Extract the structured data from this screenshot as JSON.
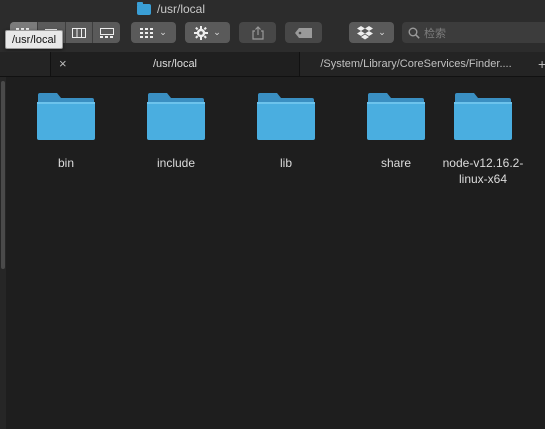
{
  "window": {
    "title": "/usr/local"
  },
  "tooltip": "/usr/local",
  "toolbar": {
    "view_modes": [
      "icon-view",
      "list-view",
      "column-view",
      "gallery-view"
    ],
    "group_chevron": "⌄",
    "action_chevron": "⌄",
    "dropbox_chevron": "⌄",
    "search_placeholder": "检索"
  },
  "tabs": [
    {
      "label": "/usr/local",
      "active": true
    },
    {
      "label": "/System/Library/CoreServices/Finder....",
      "active": false
    }
  ],
  "add_tab": "+",
  "close_tab": "×",
  "items": [
    {
      "name": "bin"
    },
    {
      "name": "include"
    },
    {
      "name": "lib"
    },
    {
      "name": "share"
    },
    {
      "name": "node-v12.16.2-linux-x64"
    }
  ],
  "colors": {
    "folder_body": "#4aaee0",
    "folder_tab": "#3a8fc2",
    "background": "#1e1e1e"
  }
}
